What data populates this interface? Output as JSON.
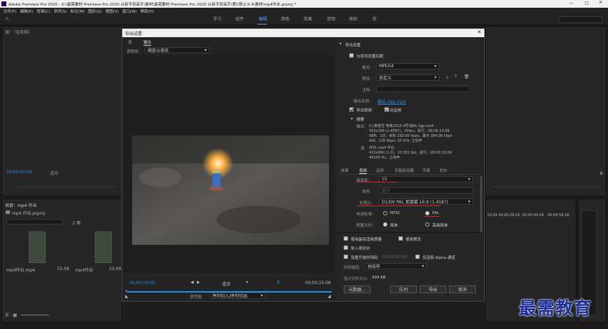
{
  "app": {
    "title": "Adobe Premiere Pro 2020 - D:\\最需要材 Premiere Pro 2020 从新手到高手\\素材\\最需要材 Premiere Pro 2020 从新手到高手\\第2章\\2.5.4\\素材\\mp4作业.prproj *"
  },
  "menu": [
    "文件(F)",
    "编辑(E)",
    "剪辑(C)",
    "序列(S)",
    "标记(M)",
    "图形(G)",
    "视图(V)",
    "窗口(W)",
    "帮助(H)"
  ],
  "workspaces": [
    "学习",
    "组件",
    "编辑",
    "颜色",
    "效果",
    "音频",
    "图形",
    "库"
  ],
  "active_workspace": "编辑",
  "left_panel": {
    "source_tab": "源：（无剪辑）",
    "timecode": "00;00;00;00",
    "fit_label": "适合",
    "project_tab": "项目：mp4 作业",
    "project_file": "mp4 作业.prproj",
    "item_count": "2 项",
    "items": [
      {
        "name": "mp4作业.mp4",
        "duration": "15;09"
      },
      {
        "name": "mp4作业",
        "duration": "15;09"
      }
    ]
  },
  "right_bg": {
    "timecode": "00;00;00;00",
    "ruler": [
      "14;29",
      "00;00;29;29",
      "00;00;44;29",
      "00;00;59;28"
    ]
  },
  "dialog": {
    "title": "导出设置",
    "source_tab": "源",
    "output_tab": "输出",
    "source_scaling_label": "源缩放:",
    "source_scaling_value": "缩放以填充",
    "timecode_left": "00;00;00;00",
    "fit_value": "适合",
    "timecode_right": "00;00;15;09",
    "source_range_label": "源范围:",
    "source_range_value": "序列切入/序列切出",
    "export_settings": {
      "header": "导出设置",
      "match_sequence": "与序列设置匹配",
      "format_label": "格式:",
      "format_value": "MPEG4",
      "preset_label": "预设:",
      "preset_value": "自定义",
      "comment_label": "注释:",
      "comment_value": "",
      "output_name_label": "输出名称:",
      "output_name_value": "输出.3gp.mp4",
      "export_video": "导出视频",
      "export_audio": "导出音频"
    },
    "summary": {
      "header": "摘要",
      "output_label": "输出:",
      "output_lines": [
        "D:\\黄枝芝 电离2033 4号\\输出.3gp.mp4",
        "352x288 (1.4587)，25fps，逐行，00;00;15;08",
        "VBR，1次，目标 192.00 kbps，最大 384.00 kbps",
        "AAC, 128 Kbps, 32 kHz, 立体声"
      ],
      "source_label": "源:",
      "source_lines": [
        "序列, mp4 作业",
        "432x960 (1.0)，23.001 fps，逐行，00;00;15;09",
        "44100 Hz，立体声"
      ]
    },
    "tabs": [
      "效果",
      "视频",
      "音频",
      "多路复用器",
      "字幕",
      "发布"
    ],
    "active_tab": "视频",
    "video": {
      "frame_rate_label": "帧速率:",
      "frame_rate_value": "15",
      "field_order_label": "场序:",
      "field_order_value": "逐行",
      "aspect_label": "长宽比:",
      "aspect_value": "D1/DV PAL 宽银幕 16:9 (1.4587)",
      "tv_standard_label": "电视标准:",
      "ntsc": "NTSC",
      "pal": "PAL",
      "profile_label": "配置文件:",
      "profile_simple": "简单",
      "profile_advanced": "高级简单"
    },
    "options": {
      "max_render_quality": "使用最高渲染质量",
      "use_previews": "使用预览",
      "import_into_project": "导入项目中",
      "set_start_timecode": "设置开始时间码",
      "start_timecode_value": "00;00;00;00",
      "render_alpha": "仅渲染 Alpha 通道",
      "time_interpolation_label": "时间插值:",
      "time_interpolation_value": "帧采样",
      "file_size_label": "估计文件大小:",
      "file_size_value": "399 KB"
    },
    "buttons": {
      "metadata": "元数据...",
      "queue": "队列",
      "export": "导出",
      "cancel": "取消"
    }
  },
  "watermark": "最需教育",
  "colors": {
    "accent": "#2d8ceb",
    "red_annotation": "#e02020",
    "watermark": "#1f2f9a"
  }
}
